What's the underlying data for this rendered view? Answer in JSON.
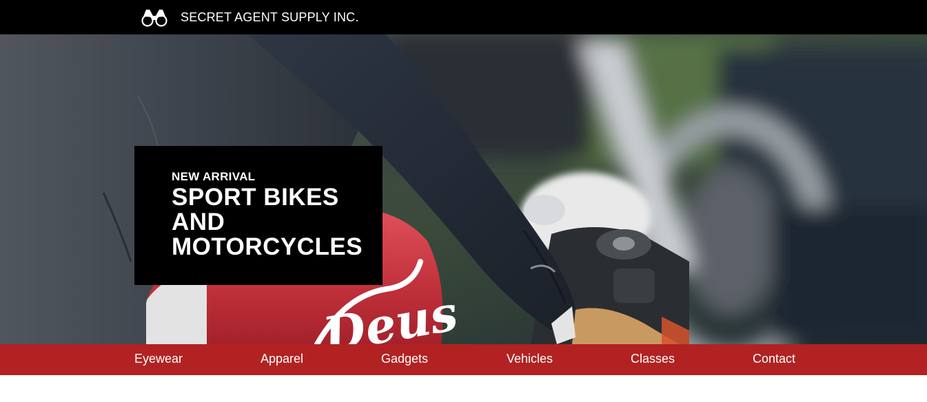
{
  "header": {
    "brand_name": "SECRET AGENT SUPPLY INC.",
    "brand_icon": "binoculars-icon"
  },
  "hero": {
    "kicker": "NEW ARRIVAL",
    "title": "SPORT BIKES\nAND\nMOTORCYCLES",
    "tank_logo_text": "Deus"
  },
  "nav": {
    "items": [
      {
        "label": "Eyewear"
      },
      {
        "label": "Apparel"
      },
      {
        "label": "Gadgets"
      },
      {
        "label": "Vehicles"
      },
      {
        "label": "Classes"
      },
      {
        "label": "Contact"
      }
    ]
  },
  "colors": {
    "header_bg": "#000000",
    "nav_bg": "#b22222",
    "promo_bg": "#000000",
    "text": "#ffffff"
  }
}
